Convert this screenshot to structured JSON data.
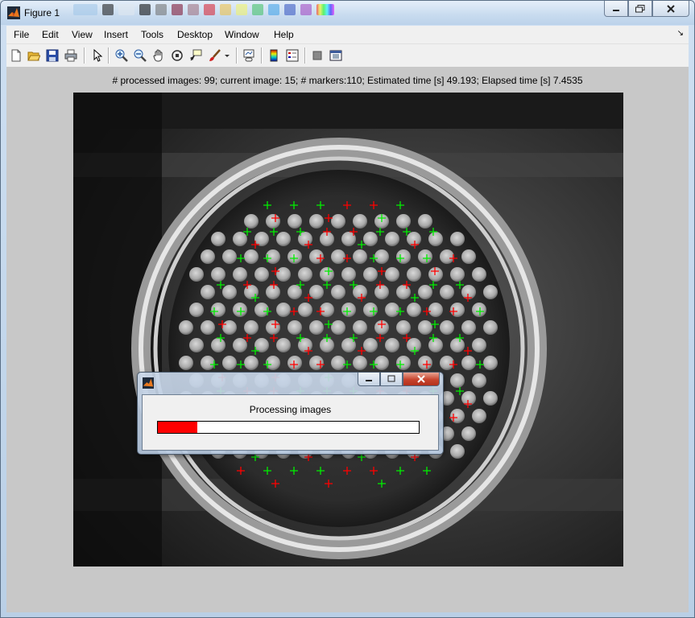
{
  "window": {
    "title": "Figure 1",
    "icon": "matlab-icon",
    "caption_icons": [
      "minimize-icon",
      "maximize-icon",
      "close-icon"
    ]
  },
  "menubar": {
    "items": [
      "File",
      "Edit",
      "View",
      "Insert",
      "Tools",
      "Desktop",
      "Window",
      "Help"
    ],
    "overflow_icon": "dock-arrow-icon"
  },
  "toolbar": {
    "icons": [
      "new-figure-icon",
      "open-file-icon",
      "save-icon",
      "print-icon",
      "edit-plot-icon",
      "zoom-in-icon",
      "zoom-out-icon",
      "pan-icon",
      "rotate-3d-icon",
      "data-cursor-icon",
      "brush-icon",
      "brush-dropdown-icon",
      "link-plot-icon",
      "insert-colorbar-icon",
      "insert-legend-icon",
      "hide-plot-tools-icon",
      "show-plot-tools-icon"
    ]
  },
  "figure": {
    "status_text": "# processed images: 99; current image: 15; # markers:110; Estimated time [s] 49.193;  Elapsed time [s] 7.4535",
    "image": {
      "subject": "grayscale image of a circular dish with a grid of round beads",
      "marker_colors": {
        "tracked": "#00ee00",
        "untracked": "#ff0000"
      },
      "marker_symbol": "+"
    }
  },
  "progress_dialog": {
    "message": "Processing images",
    "progress_fraction": 0.15,
    "fill_color": "#ff0000",
    "caption_icons": [
      "minimize-icon",
      "maximize-icon",
      "close-icon"
    ]
  }
}
